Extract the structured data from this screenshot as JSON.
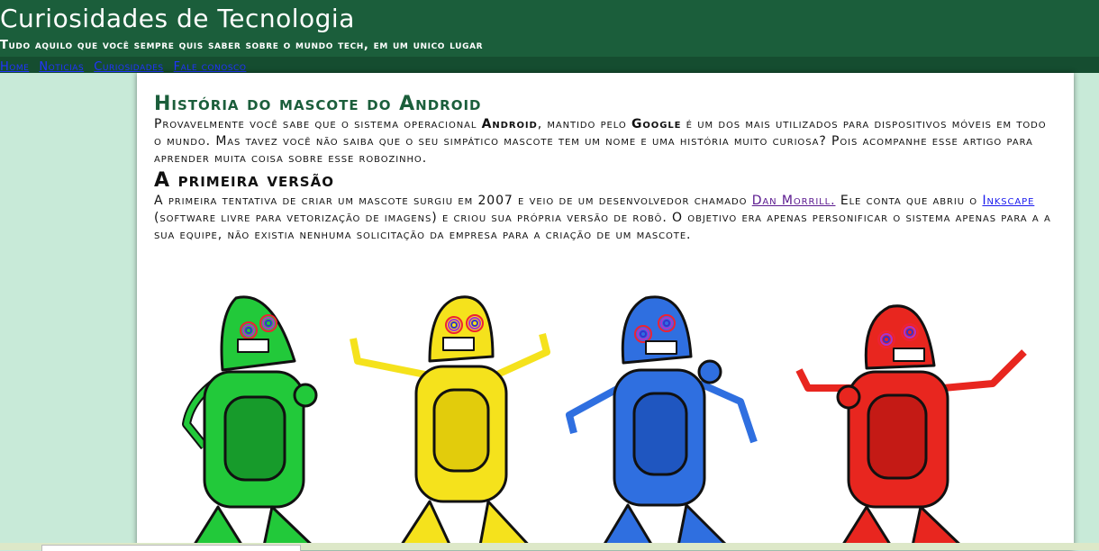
{
  "site": {
    "title": "Curiosidades de Tecnologia",
    "tagline": "Tudo aquilo que você sempre quis saber sobre o mundo tech, em um unico lugar"
  },
  "nav": {
    "items": [
      {
        "label": "Home"
      },
      {
        "label": "Noticias"
      },
      {
        "label": "Curiosidades"
      },
      {
        "label": "Fale conosco"
      }
    ]
  },
  "article": {
    "title": "História do mascote do Android",
    "intro": {
      "part1": "Provavelmente você sabe que o sistema operacional ",
      "android": "Android",
      "part2": ", mantido pelo ",
      "google": "Google",
      "part3": " é um dos mais utilizados para dispositivos móveis em todo o mundo. Mas tavez você não saiba que o seu simpático mascote tem um nome e uma história muito curiosa? Pois acompanhe esse artigo para aprender muita coisa sobre esse robozinho."
    },
    "section1": {
      "title": "A primeira versão",
      "part1": "A primeira tentativa de criar um mascote surgiu em 2007 e veio de um desenvolvedor chamado ",
      "link_dan": "Dan Morrill.",
      "part2": " Ele conta que abriu o ",
      "link_inkscape": "Inkscape",
      "part3": " (software livre para vetorização de imagens) e criou sua própria versão de robô. O objetivo era apenas personificar o sistema apenas para a a sua equipe, não existia nenhuma solicitação da empresa para a criação de um mascote."
    }
  },
  "colors": {
    "header_bg": "#1b5e3b",
    "nav_bg": "#154d30",
    "page_bg": "#c8ead8",
    "robot_green": "#22c93a",
    "robot_yellow": "#f5e21c",
    "robot_blue": "#2f6fe0",
    "robot_red": "#e8261f"
  }
}
